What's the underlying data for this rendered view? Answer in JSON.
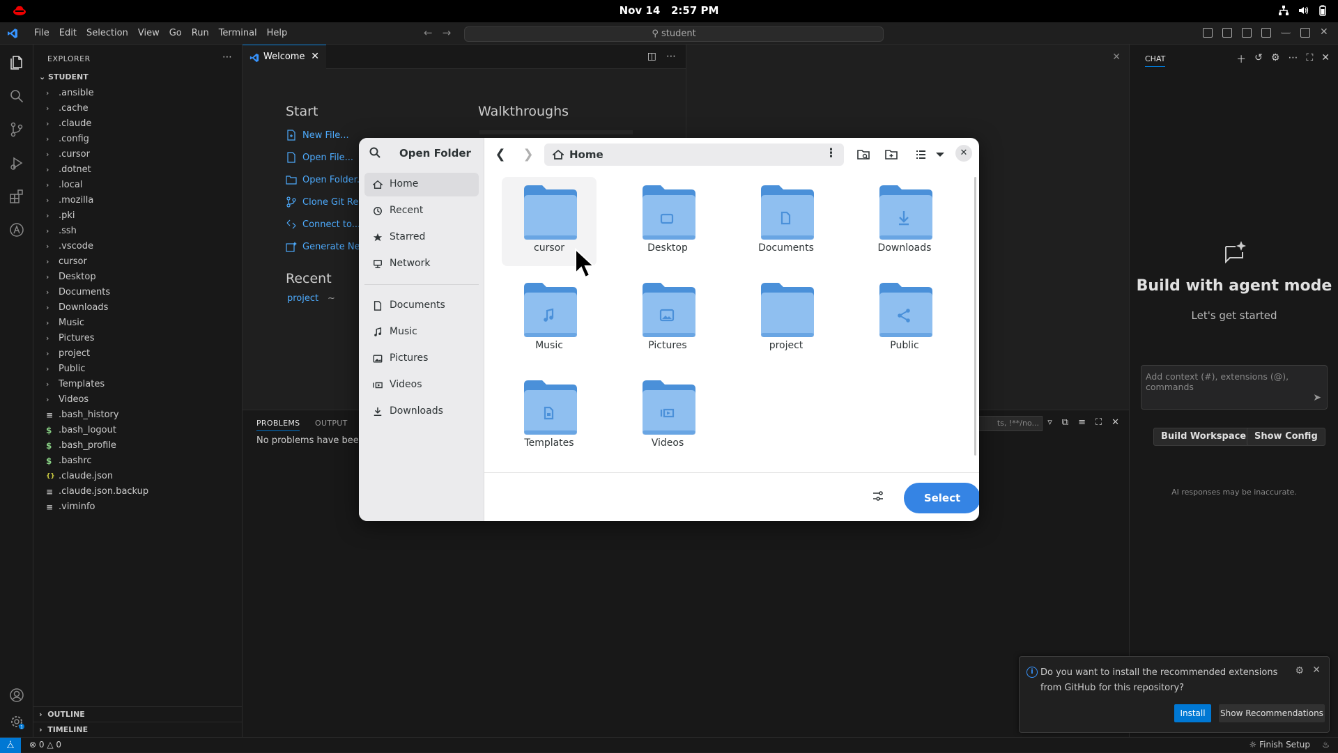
{
  "topbar": {
    "date": "Nov 14",
    "time": "2:57 PM"
  },
  "titlebar": {
    "menu": [
      "File",
      "Edit",
      "Selection",
      "View",
      "Go",
      "Run",
      "Terminal",
      "Help"
    ],
    "search_text": "student"
  },
  "explorer": {
    "header": "EXPLORER",
    "root": "STUDENT",
    "items": [
      {
        "name": ".ansible",
        "type": "folder"
      },
      {
        "name": ".cache",
        "type": "folder"
      },
      {
        "name": ".claude",
        "type": "folder"
      },
      {
        "name": ".config",
        "type": "folder"
      },
      {
        "name": ".cursor",
        "type": "folder"
      },
      {
        "name": ".dotnet",
        "type": "folder"
      },
      {
        "name": ".local",
        "type": "folder"
      },
      {
        "name": ".mozilla",
        "type": "folder"
      },
      {
        "name": ".pki",
        "type": "folder"
      },
      {
        "name": ".ssh",
        "type": "folder"
      },
      {
        "name": ".vscode",
        "type": "folder"
      },
      {
        "name": "cursor",
        "type": "folder"
      },
      {
        "name": "Desktop",
        "type": "folder"
      },
      {
        "name": "Documents",
        "type": "folder"
      },
      {
        "name": "Downloads",
        "type": "folder"
      },
      {
        "name": "Music",
        "type": "folder"
      },
      {
        "name": "Pictures",
        "type": "folder"
      },
      {
        "name": "project",
        "type": "folder"
      },
      {
        "name": "Public",
        "type": "folder"
      },
      {
        "name": "Templates",
        "type": "folder"
      },
      {
        "name": "Videos",
        "type": "folder"
      },
      {
        "name": ".bash_history",
        "type": "text"
      },
      {
        "name": ".bash_logout",
        "type": "shell"
      },
      {
        "name": ".bash_profile",
        "type": "shell"
      },
      {
        "name": ".bashrc",
        "type": "shell"
      },
      {
        "name": ".claude.json",
        "type": "json"
      },
      {
        "name": ".claude.json.backup",
        "type": "text"
      },
      {
        "name": ".viminfo",
        "type": "text"
      }
    ],
    "outline": "OUTLINE",
    "timeline": "TIMELINE"
  },
  "editor": {
    "tab_label": "Welcome",
    "start_title": "Start",
    "start_items": [
      "New File...",
      "Open File...",
      "Open Folder...",
      "Clone Git Re",
      "Connect to...",
      "Generate Ne"
    ],
    "walkthroughs_title": "Walkthroughs",
    "recent_title": "Recent",
    "recent_item": "project",
    "recent_path": "~"
  },
  "panel": {
    "tabs": [
      "PROBLEMS",
      "OUTPUT"
    ],
    "message": "No problems have been d",
    "filter_text": "ts, !**/no..."
  },
  "chat": {
    "header": "CHAT",
    "headline": "Build with agent mode",
    "subline": "Let's get started",
    "input_placeholder": "Add context (#), extensions (@), commands",
    "buttons": [
      "Build Workspace",
      "Show Config"
    ],
    "disclaimer": "AI responses may be inaccurate."
  },
  "notification": {
    "message": "Do you want to install the recommended extensions from GitHub for this repository?",
    "install_label": "Install",
    "show_label": "Show Recommendations"
  },
  "statusbar": {
    "errors": "0",
    "warnings": "0",
    "finish_setup": "Finish Setup"
  },
  "dialog": {
    "title": "Open Folder",
    "location": "Home",
    "places": [
      {
        "label": "Home",
        "icon": "home-icon",
        "active": true
      },
      {
        "label": "Recent",
        "icon": "clock-icon"
      },
      {
        "label": "Starred",
        "icon": "star-icon"
      },
      {
        "label": "Network",
        "icon": "network-icon"
      }
    ],
    "bookmarks": [
      {
        "label": "Documents",
        "icon": "document-icon"
      },
      {
        "label": "Music",
        "icon": "music-icon"
      },
      {
        "label": "Pictures",
        "icon": "picture-icon"
      },
      {
        "label": "Videos",
        "icon": "video-icon"
      },
      {
        "label": "Downloads",
        "icon": "download-icon"
      }
    ],
    "folders": [
      {
        "name": "cursor",
        "emblem": "none"
      },
      {
        "name": "Desktop",
        "emblem": "desktop"
      },
      {
        "name": "Documents",
        "emblem": "document"
      },
      {
        "name": "Downloads",
        "emblem": "download"
      },
      {
        "name": "Music",
        "emblem": "music"
      },
      {
        "name": "Pictures",
        "emblem": "picture"
      },
      {
        "name": "project",
        "emblem": "none"
      },
      {
        "name": "Public",
        "emblem": "share"
      },
      {
        "name": "Templates",
        "emblem": "template"
      },
      {
        "name": "Videos",
        "emblem": "video"
      }
    ],
    "select_label": "Select",
    "folder_color": "#4a90d9",
    "folder_light": "#8fbff0",
    "accent": "#3584e4"
  }
}
